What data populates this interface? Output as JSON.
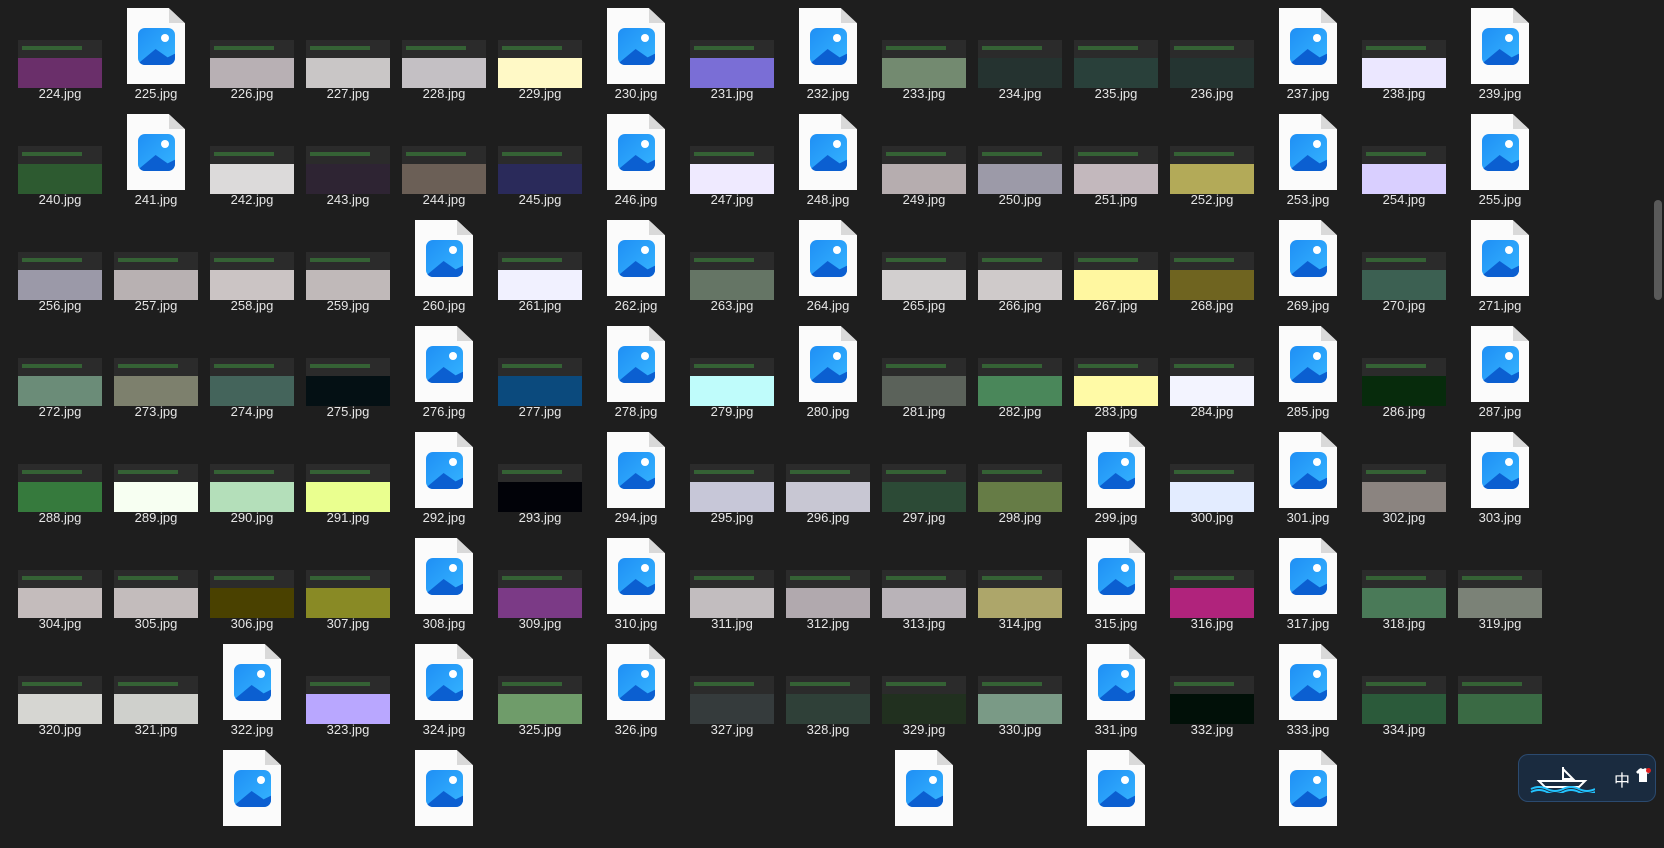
{
  "files": [
    {
      "name": "224.jpg",
      "kind": "thumb",
      "color": "#6a2f6a",
      "band": "#2b2b2b"
    },
    {
      "name": "225.jpg",
      "kind": "icon"
    },
    {
      "name": "226.jpg",
      "kind": "thumb",
      "color": "#b8b0b4",
      "band": "#2b2b2b"
    },
    {
      "name": "227.jpg",
      "kind": "thumb",
      "color": "#c9c6c6",
      "band": "#2b2b2b"
    },
    {
      "name": "228.jpg",
      "kind": "thumb",
      "color": "#c4c0c4",
      "band": "#2b2b2b"
    },
    {
      "name": "229.jpg",
      "kind": "thumb",
      "color": "#fff9c6",
      "band": "#2b2b2b"
    },
    {
      "name": "230.jpg",
      "kind": "icon"
    },
    {
      "name": "231.jpg",
      "kind": "thumb",
      "color": "#7a6ed6",
      "band": "#2b2b2b"
    },
    {
      "name": "232.jpg",
      "kind": "icon"
    },
    {
      "name": "233.jpg",
      "kind": "thumb",
      "color": "#738a70",
      "band": "#2b2b2b"
    },
    {
      "name": "234.jpg",
      "kind": "thumb",
      "color": "#253330",
      "band": "#2b2b2b"
    },
    {
      "name": "235.jpg",
      "kind": "thumb",
      "color": "#29403a",
      "band": "#2b2b2b"
    },
    {
      "name": "236.jpg",
      "kind": "thumb",
      "color": "#243431",
      "band": "#2b2b2b"
    },
    {
      "name": "237.jpg",
      "kind": "icon"
    },
    {
      "name": "238.jpg",
      "kind": "thumb",
      "color": "#ebe7ff",
      "band": "#2b2b2b"
    },
    {
      "name": "239.jpg",
      "kind": "icon"
    },
    {
      "name": "240.jpg",
      "kind": "thumb",
      "color": "#2d5a30",
      "band": "#2b2b2b"
    },
    {
      "name": "241.jpg",
      "kind": "icon"
    },
    {
      "name": "242.jpg",
      "kind": "thumb",
      "color": "#dcdada",
      "band": "#2b2b2b"
    },
    {
      "name": "243.jpg",
      "kind": "thumb",
      "color": "#2e2433",
      "band": "#2b2b2b"
    },
    {
      "name": "244.jpg",
      "kind": "thumb",
      "color": "#6b5f56",
      "band": "#2b2b2b"
    },
    {
      "name": "245.jpg",
      "kind": "thumb",
      "color": "#2a2a5a",
      "band": "#2b2b2b"
    },
    {
      "name": "246.jpg",
      "kind": "icon"
    },
    {
      "name": "247.jpg",
      "kind": "thumb",
      "color": "#efeaff",
      "band": "#2b2b2b"
    },
    {
      "name": "248.jpg",
      "kind": "icon"
    },
    {
      "name": "249.jpg",
      "kind": "thumb",
      "color": "#b6adaf",
      "band": "#2b2b2b"
    },
    {
      "name": "250.jpg",
      "kind": "thumb",
      "color": "#9c9aa8",
      "band": "#2b2b2b"
    },
    {
      "name": "251.jpg",
      "kind": "thumb",
      "color": "#c3b8bd",
      "band": "#2b2b2b"
    },
    {
      "name": "252.jpg",
      "kind": "thumb",
      "color": "#b3aa58",
      "band": "#2b2b2b"
    },
    {
      "name": "253.jpg",
      "kind": "icon"
    },
    {
      "name": "254.jpg",
      "kind": "thumb",
      "color": "#d9cfff",
      "band": "#2b2b2b"
    },
    {
      "name": "255.jpg",
      "kind": "icon"
    },
    {
      "name": "256.jpg",
      "kind": "thumb",
      "color": "#9b99a8",
      "band": "#2b2b2b"
    },
    {
      "name": "257.jpg",
      "kind": "thumb",
      "color": "#b8b1b2",
      "band": "#2b2b2b"
    },
    {
      "name": "258.jpg",
      "kind": "thumb",
      "color": "#cbc4c4",
      "band": "#2b2b2b"
    },
    {
      "name": "259.jpg",
      "kind": "thumb",
      "color": "#c0b9b9",
      "band": "#2b2b2b"
    },
    {
      "name": "260.jpg",
      "kind": "icon"
    },
    {
      "name": "261.jpg",
      "kind": "thumb",
      "color": "#f1f1ff",
      "band": "#2b2b2b"
    },
    {
      "name": "262.jpg",
      "kind": "icon"
    },
    {
      "name": "263.jpg",
      "kind": "thumb",
      "color": "#657565",
      "band": "#2b2b2b"
    },
    {
      "name": "264.jpg",
      "kind": "icon"
    },
    {
      "name": "265.jpg",
      "kind": "thumb",
      "color": "#d2cfcf",
      "band": "#2b2b2b"
    },
    {
      "name": "266.jpg",
      "kind": "thumb",
      "color": "#cfcaca",
      "band": "#2b2b2b"
    },
    {
      "name": "267.jpg",
      "kind": "thumb",
      "color": "#fff7a0",
      "band": "#2b2b2b"
    },
    {
      "name": "268.jpg",
      "kind": "thumb",
      "color": "#6f6420",
      "band": "#2b2b2b"
    },
    {
      "name": "269.jpg",
      "kind": "icon"
    },
    {
      "name": "270.jpg",
      "kind": "thumb",
      "color": "#3c6052",
      "band": "#2b2b2b"
    },
    {
      "name": "271.jpg",
      "kind": "icon"
    },
    {
      "name": "272.jpg",
      "kind": "thumb",
      "color": "#6b8c78",
      "band": "#2b2b2b"
    },
    {
      "name": "273.jpg",
      "kind": "thumb",
      "color": "#7d806d",
      "band": "#2b2b2b"
    },
    {
      "name": "274.jpg",
      "kind": "thumb",
      "color": "#44645b",
      "band": "#2b2b2b"
    },
    {
      "name": "275.jpg",
      "kind": "thumb",
      "color": "#041014",
      "band": "#2b2b2b"
    },
    {
      "name": "276.jpg",
      "kind": "icon"
    },
    {
      "name": "277.jpg",
      "kind": "thumb",
      "color": "#0b4a7d",
      "band": "#2b2b2b"
    },
    {
      "name": "278.jpg",
      "kind": "icon"
    },
    {
      "name": "279.jpg",
      "kind": "thumb",
      "color": "#bffcfb",
      "band": "#2b2b2b"
    },
    {
      "name": "280.jpg",
      "kind": "icon"
    },
    {
      "name": "281.jpg",
      "kind": "thumb",
      "color": "#5b625a",
      "band": "#2b2b2b"
    },
    {
      "name": "282.jpg",
      "kind": "thumb",
      "color": "#4a875a",
      "band": "#2b2b2b"
    },
    {
      "name": "283.jpg",
      "kind": "thumb",
      "color": "#fffaa6",
      "band": "#2b2b2b"
    },
    {
      "name": "284.jpg",
      "kind": "thumb",
      "color": "#f3f4ff",
      "band": "#2b2b2b"
    },
    {
      "name": "285.jpg",
      "kind": "icon"
    },
    {
      "name": "286.jpg",
      "kind": "thumb",
      "color": "#072b0c",
      "band": "#2b2b2b"
    },
    {
      "name": "287.jpg",
      "kind": "icon"
    },
    {
      "name": "288.jpg",
      "kind": "thumb",
      "color": "#367a3d",
      "band": "#2b2b2b"
    },
    {
      "name": "289.jpg",
      "kind": "thumb",
      "color": "#f7fff2",
      "band": "#2b2b2b"
    },
    {
      "name": "290.jpg",
      "kind": "thumb",
      "color": "#b4dfba",
      "band": "#2b2b2b"
    },
    {
      "name": "291.jpg",
      "kind": "thumb",
      "color": "#eaff8f",
      "band": "#2b2b2b"
    },
    {
      "name": "292.jpg",
      "kind": "icon"
    },
    {
      "name": "293.jpg",
      "kind": "thumb",
      "color": "#010208",
      "band": "#2b2b2b"
    },
    {
      "name": "294.jpg",
      "kind": "icon"
    },
    {
      "name": "295.jpg",
      "kind": "thumb",
      "color": "#c7c7d8",
      "band": "#2b2b2b"
    },
    {
      "name": "296.jpg",
      "kind": "thumb",
      "color": "#c8c7d3",
      "band": "#2b2b2b"
    },
    {
      "name": "297.jpg",
      "kind": "thumb",
      "color": "#2c4a36",
      "band": "#2b2b2b"
    },
    {
      "name": "298.jpg",
      "kind": "thumb",
      "color": "#667c46",
      "band": "#2b2b2b"
    },
    {
      "name": "299.jpg",
      "kind": "icon"
    },
    {
      "name": "300.jpg",
      "kind": "thumb",
      "color": "#e3ecff",
      "band": "#2b2b2b"
    },
    {
      "name": "301.jpg",
      "kind": "icon"
    },
    {
      "name": "302.jpg",
      "kind": "thumb",
      "color": "#8b8480",
      "band": "#2b2b2b"
    },
    {
      "name": "303.jpg",
      "kind": "icon"
    },
    {
      "name": "304.jpg",
      "kind": "thumb",
      "color": "#c4bcbc",
      "band": "#2b2b2b"
    },
    {
      "name": "305.jpg",
      "kind": "thumb",
      "color": "#c3bcbc",
      "band": "#2b2b2b"
    },
    {
      "name": "306.jpg",
      "kind": "thumb",
      "color": "#4a4100",
      "band": "#2b2b2b"
    },
    {
      "name": "307.jpg",
      "kind": "thumb",
      "color": "#898a25",
      "band": "#2b2b2b"
    },
    {
      "name": "308.jpg",
      "kind": "icon"
    },
    {
      "name": "309.jpg",
      "kind": "thumb",
      "color": "#7b3a86",
      "band": "#2b2b2b"
    },
    {
      "name": "310.jpg",
      "kind": "icon"
    },
    {
      "name": "311.jpg",
      "kind": "thumb",
      "color": "#c2bdbf",
      "band": "#2b2b2b"
    },
    {
      "name": "312.jpg",
      "kind": "thumb",
      "color": "#b1a9ae",
      "band": "#2b2b2b"
    },
    {
      "name": "313.jpg",
      "kind": "thumb",
      "color": "#b9b3b8",
      "band": "#2b2b2b"
    },
    {
      "name": "314.jpg",
      "kind": "thumb",
      "color": "#ada66a",
      "band": "#2b2b2b"
    },
    {
      "name": "315.jpg",
      "kind": "icon"
    },
    {
      "name": "316.jpg",
      "kind": "thumb",
      "color": "#b0237c",
      "band": "#2b2b2b"
    },
    {
      "name": "317.jpg",
      "kind": "icon"
    },
    {
      "name": "318.jpg",
      "kind": "thumb",
      "color": "#4a7a58",
      "band": "#2b2b2b"
    },
    {
      "name": "319.jpg",
      "kind": "thumb",
      "color": "#7b8277",
      "band": "#2b2b2b"
    },
    {
      "name": "320.jpg",
      "kind": "thumb",
      "color": "#d6d6d2",
      "band": "#2b2b2b"
    },
    {
      "name": "321.jpg",
      "kind": "thumb",
      "color": "#cfd0cc",
      "band": "#2b2b2b"
    },
    {
      "name": "322.jpg",
      "kind": "icon"
    },
    {
      "name": "323.jpg",
      "kind": "thumb",
      "color": "#b9a7ff",
      "band": "#2b2b2b"
    },
    {
      "name": "324.jpg",
      "kind": "icon"
    },
    {
      "name": "325.jpg",
      "kind": "thumb",
      "color": "#6f9c6a",
      "band": "#2b2b2b"
    },
    {
      "name": "326.jpg",
      "kind": "icon"
    },
    {
      "name": "327.jpg",
      "kind": "thumb",
      "color": "#353b3c",
      "band": "#2b2b2b"
    },
    {
      "name": "328.jpg",
      "kind": "thumb",
      "color": "#2f4038",
      "band": "#2b2b2b"
    },
    {
      "name": "329.jpg",
      "kind": "thumb",
      "color": "#21301f",
      "band": "#2b2b2b"
    },
    {
      "name": "330.jpg",
      "kind": "thumb",
      "color": "#7a9a86",
      "band": "#2b2b2b"
    },
    {
      "name": "331.jpg",
      "kind": "icon"
    },
    {
      "name": "332.jpg",
      "kind": "thumb",
      "color": "#011008",
      "band": "#2b2b2b"
    },
    {
      "name": "333.jpg",
      "kind": "icon"
    },
    {
      "name": "334.jpg",
      "kind": "thumb",
      "color": "#2b5a3a",
      "band": "#2b2b2b"
    },
    {
      "name": "",
      "kind": "thumb",
      "color": "#3a6a44",
      "band": "#2b2b2b"
    }
  ],
  "partial_row_icons": [
    2,
    4,
    9,
    11,
    13
  ],
  "tray": {
    "ime_label": "中"
  },
  "colors": {
    "background": "#1e1e1e",
    "label": "#e6e6e6",
    "file_icon_blue": "#1f8ff5"
  }
}
